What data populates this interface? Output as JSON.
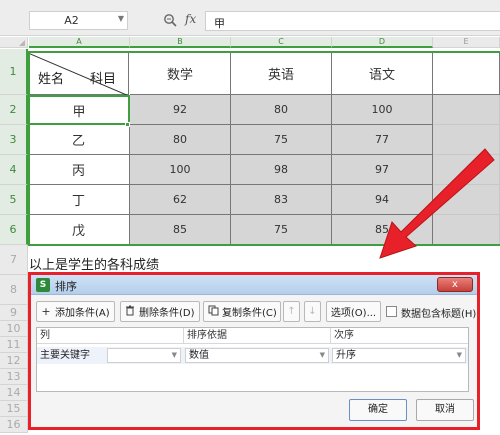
{
  "formula_bar": {
    "name_box": "A2",
    "fx_label": "fx",
    "formula_value": "甲"
  },
  "sheet": {
    "columns": [
      "A",
      "B",
      "C",
      "D",
      "E"
    ],
    "rows": [
      "1",
      "2",
      "3",
      "4",
      "5",
      "6",
      "7",
      "8",
      "9",
      "10",
      "11",
      "12",
      "13",
      "14",
      "15",
      "16"
    ],
    "header_cell": {
      "left_label": "姓名",
      "right_label": "科目"
    },
    "subject_headers": [
      "数学",
      "英语",
      "语文"
    ],
    "data_rows": [
      {
        "name": "甲",
        "values": [
          "92",
          "80",
          "100"
        ]
      },
      {
        "name": "乙",
        "values": [
          "80",
          "75",
          "77"
        ]
      },
      {
        "name": "丙",
        "values": [
          "100",
          "98",
          "97"
        ]
      },
      {
        "name": "丁",
        "values": [
          "62",
          "83",
          "94"
        ]
      },
      {
        "name": "戊",
        "values": [
          "85",
          "75",
          "85"
        ]
      }
    ],
    "note": "以上是学生的各科成绩"
  },
  "dialog": {
    "logo": "S",
    "title": "排序",
    "close": "x",
    "buttons": {
      "add": "添加条件(A)",
      "delete": "删除条件(D)",
      "copy": "复制条件(C)",
      "up": "↑",
      "down": "↓",
      "options": "选项(O)...",
      "header_checkbox": "数据包含标题(H)"
    },
    "grid_headers": [
      "列",
      "排序依据",
      "次序"
    ],
    "condition_row": {
      "label": "主要关键字",
      "column_value": "",
      "basis": "数值",
      "order": "升序"
    },
    "ok": "确定",
    "cancel": "取消"
  },
  "colors": {
    "selection_green": "#3f9f3f",
    "annotation_red": "#e8202a",
    "shaded_cell": "#d6d6d6"
  }
}
